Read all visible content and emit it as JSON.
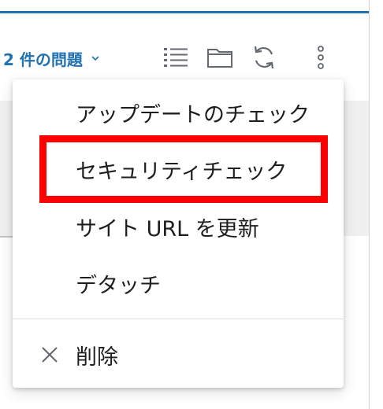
{
  "toolbar": {
    "issues_label": "2 件の問題",
    "icons": [
      "list-icon",
      "folder-icon",
      "refresh-icon",
      "more-vertical-icon"
    ]
  },
  "menu": {
    "items": [
      {
        "label": "アップデートのチェック"
      },
      {
        "label": "セキュリティチェック",
        "highlighted": true
      },
      {
        "label": "サイト URL を更新"
      },
      {
        "label": "デタッチ"
      }
    ],
    "delete_label": "削除"
  },
  "colors": {
    "accent": "#2271b1",
    "highlight": "#ff0000",
    "text": "#1e1e1e",
    "icon": "#646970"
  }
}
